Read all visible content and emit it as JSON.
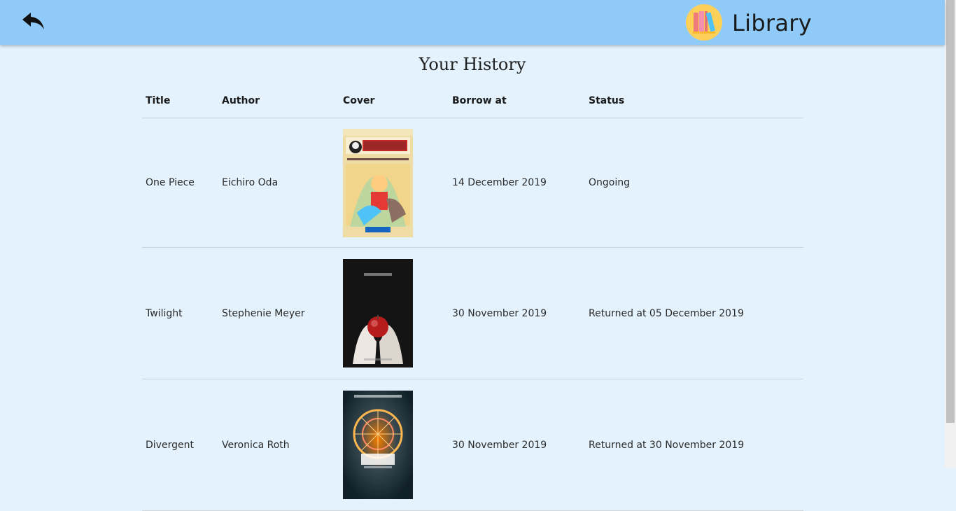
{
  "header": {
    "app_title": "Library",
    "back_icon": "reply-arrow-icon",
    "logo_icon": "books-logo-icon"
  },
  "page": {
    "title": "Your History"
  },
  "table": {
    "headers": {
      "title": "Title",
      "author": "Author",
      "cover": "Cover",
      "borrow_at": "Borrow at",
      "status": "Status"
    },
    "rows": [
      {
        "title": "One Piece",
        "author": "Eichiro Oda",
        "borrow_at": "14 December 2019",
        "status": "Ongoing"
      },
      {
        "title": "Twilight",
        "author": "Stephenie Meyer",
        "borrow_at": "30 November 2019",
        "status": "Returned at 05 December 2019"
      },
      {
        "title": "Divergent",
        "author": "Veronica Roth",
        "borrow_at": "30 November 2019",
        "status": "Returned at 30 November 2019"
      }
    ]
  },
  "colors": {
    "header_bg": "#90caf9",
    "page_bg": "#e3f2fd",
    "divider": "#c8d2d8"
  }
}
